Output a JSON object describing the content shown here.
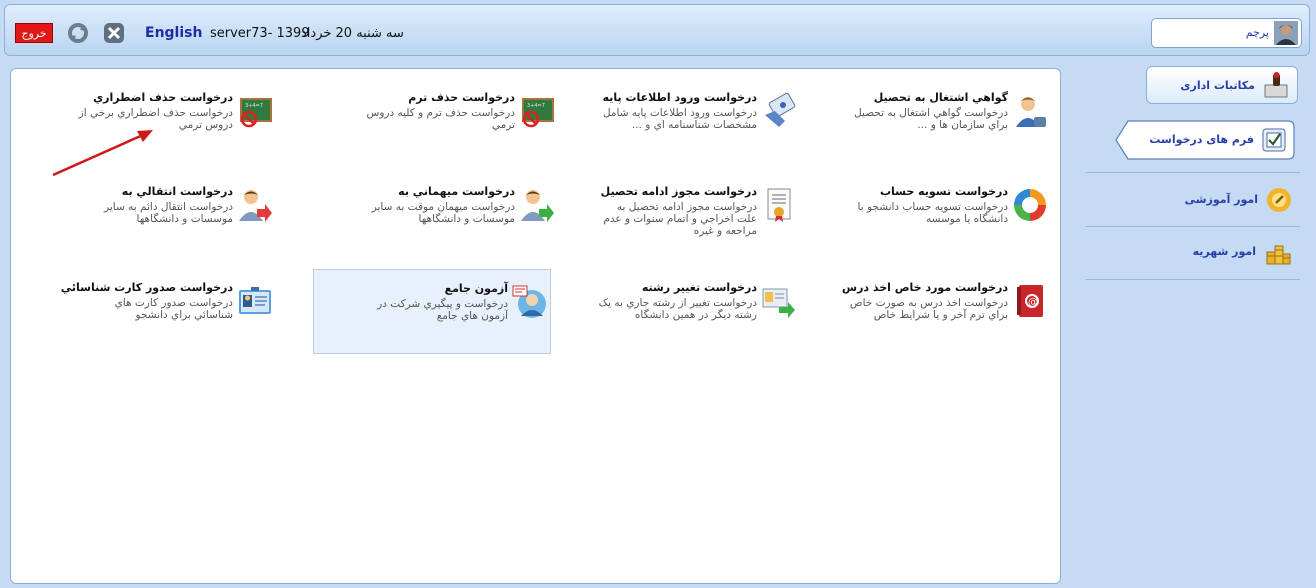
{
  "header": {
    "logout_label": "خروج",
    "language": "English",
    "server": "server73- 1399",
    "date": "سه شنبه 20 خرداد"
  },
  "user": {
    "name": "پرچم"
  },
  "sidebar": {
    "items": [
      {
        "label": "مکاتبات اداری"
      },
      {
        "label": "فرم های درخواست"
      },
      {
        "label": "امور آموزشی"
      },
      {
        "label": "امور شهریه"
      }
    ]
  },
  "cards": [
    {
      "title": "گواهي اشتغال به تحصيل",
      "desc": "درخواست گواهي اشتغال به تحصيل براي سازمان ها و ..."
    },
    {
      "title": "درخواست ورود اطلاعات پايه",
      "desc": "درخواست ورود اطلاعات پايه شامل مشخصات شناسنامه اي و ..."
    },
    {
      "title": "درخواست حذف ترم",
      "desc": "درخواست حذف ترم و کليه دروس ترمي"
    },
    {
      "title": "درخواست حذف اضطراري",
      "desc": "درخواست حذف اضطراري برخي از دروس ترمي"
    },
    {
      "title": "درخواست تسويه حساب",
      "desc": "درخواست تسويه حساب دانشجو با دانشگاه يا موسسه"
    },
    {
      "title": "درخواست مجوز ادامه تحصيل",
      "desc": "درخواست مجوز ادامه تحصيل به علت اخراجي و اتمام سنوات و عدم مراجعه و غيره"
    },
    {
      "title": "درخواست ميهماني به",
      "desc": "درخواست ميهمان موقت به ساير موسسات و دانشگاهها"
    },
    {
      "title": "درخواست انتقالي به",
      "desc": "درخواست انتقال دائم به ساير موسسات و دانشگاهها"
    },
    {
      "title": "درخواست مورد خاص اخذ درس",
      "desc": "درخواست اخذ درس به صورت خاص براي ترم آخر و يا شرايط خاص"
    },
    {
      "title": "درخواست تغيير رشته",
      "desc": "درخواست تغيير از رشته جاري به يک رشته ديگر در همين دانشگاه"
    },
    {
      "title": "آزمون جامع",
      "desc": "درخواست و پيگيري شرکت در آزمون هاي جامع"
    },
    {
      "title": "درخواست صدور کارت شناسائي",
      "desc": "درخواست صدور کارت هاي شناسائي براي دانشجو"
    }
  ]
}
